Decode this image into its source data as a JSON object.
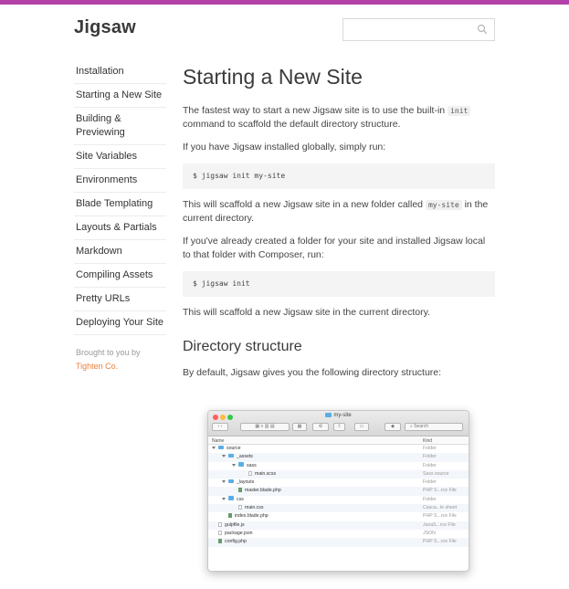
{
  "header": {
    "logo": "Jigsaw",
    "search_placeholder": ""
  },
  "sidebar": {
    "items": [
      {
        "label": "Installation"
      },
      {
        "label": "Starting a New Site"
      },
      {
        "label": "Building & Previewing"
      },
      {
        "label": "Site Variables"
      },
      {
        "label": "Environments"
      },
      {
        "label": "Blade Templating"
      },
      {
        "label": "Layouts & Partials"
      },
      {
        "label": "Markdown"
      },
      {
        "label": "Compiling Assets"
      },
      {
        "label": "Pretty URLs"
      },
      {
        "label": "Deploying Your Site"
      }
    ],
    "brought_by": "Brought to you by",
    "brought_link": "Tighten Co."
  },
  "main": {
    "title": "Starting a New Site",
    "p1_a": "The fastest way to start a new Jigsaw site is to use the built-in ",
    "p1_code": "init",
    "p1_b": " command to scaffold the default directory structure.",
    "p2": "If you have Jigsaw installed globally, simply run:",
    "code1": "$ jigsaw init my-site",
    "p3_a": "This will scaffold a new Jigsaw site in a new folder called ",
    "p3_code": "my-site",
    "p3_b": " in the current directory.",
    "p4": "If you've already created a folder for your site and installed Jigsaw local to that folder with Composer, run:",
    "code2": "$ jigsaw init",
    "p5": "This will scaffold a new Jigsaw site in the current directory.",
    "h2": "Directory structure",
    "p6": "By default, Jigsaw gives you the following directory structure:"
  },
  "finder": {
    "title": "my-site",
    "search_label": "Search",
    "col_name": "Name",
    "col_kind": "Kind",
    "rows": [
      {
        "name": "source",
        "kind": "Folder",
        "type": "folder",
        "depth": 0,
        "open": true
      },
      {
        "name": "_assets",
        "kind": "Folder",
        "type": "folder",
        "depth": 1,
        "open": true
      },
      {
        "name": "sass",
        "kind": "Folder",
        "type": "folder",
        "depth": 2,
        "open": true
      },
      {
        "name": "main.scss",
        "kind": "Sass source",
        "type": "doc",
        "depth": 3,
        "open": false
      },
      {
        "name": "_layouts",
        "kind": "Folder",
        "type": "folder",
        "depth": 1,
        "open": true
      },
      {
        "name": "master.blade.php",
        "kind": "PHP S...rce File",
        "type": "php",
        "depth": 2,
        "open": false
      },
      {
        "name": "css",
        "kind": "Folder",
        "type": "folder",
        "depth": 1,
        "open": true
      },
      {
        "name": "main.css",
        "kind": "Casca...le sheet",
        "type": "doc",
        "depth": 2,
        "open": false
      },
      {
        "name": "index.blade.php",
        "kind": "PHP S...rce File",
        "type": "php",
        "depth": 1,
        "open": false
      },
      {
        "name": "gulpfile.js",
        "kind": "JavaS...rce File",
        "type": "doc",
        "depth": 0,
        "open": false
      },
      {
        "name": "package.json",
        "kind": "JSON",
        "type": "doc",
        "depth": 0,
        "open": false
      },
      {
        "name": "config.php",
        "kind": "PHP S...rce File",
        "type": "php",
        "depth": 0,
        "open": false
      }
    ]
  },
  "colors": {
    "accent_bar": "#b341a8",
    "link": "#e8813c",
    "folder": "#5aaee6"
  }
}
